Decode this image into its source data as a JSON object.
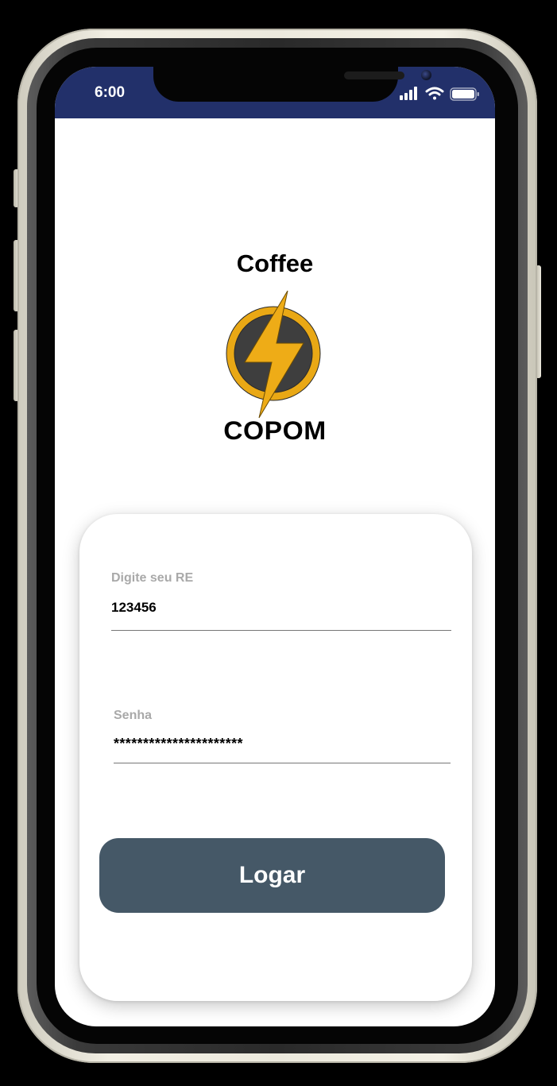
{
  "status_bar": {
    "time": "6:00",
    "background_color": "#22306a",
    "icons": [
      "cellular-signal-icon",
      "wifi-icon",
      "battery-icon"
    ]
  },
  "logo": {
    "top_text": "Coffee",
    "bottom_text": "COPOM",
    "mark_icon": "lightning-bolt-icon",
    "colors": {
      "ring": "#e9a815",
      "disc": "#3e3e3e",
      "bolt": "#eeac17"
    }
  },
  "login_form": {
    "re_field": {
      "label": "Digite seu RE",
      "value": "123456"
    },
    "password_field": {
      "label": "Senha",
      "value": "**********************"
    },
    "submit_button": {
      "label": "Logar",
      "color": "#455867"
    }
  }
}
